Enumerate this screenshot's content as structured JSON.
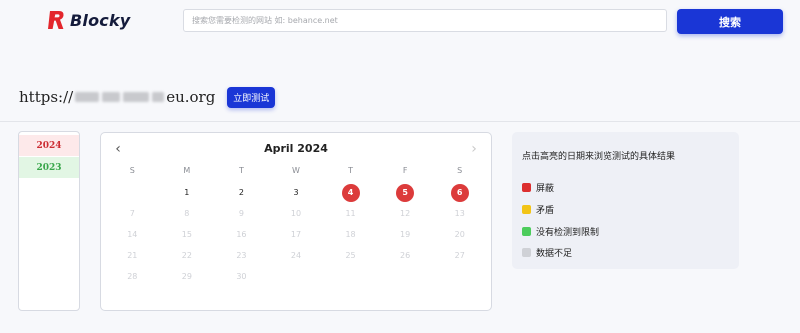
{
  "header": {
    "logo_text": "Blocky",
    "search": {
      "placeholder": "搜索您需要检测的网站 如: behance.net",
      "value": ""
    },
    "search_button": "搜索"
  },
  "target": {
    "url_prefix": "https://",
    "url_suffix": "eu.org",
    "test_button": "立即测试"
  },
  "years": [
    {
      "label": "2024",
      "status": "blocked"
    },
    {
      "label": "2023",
      "status": "ok"
    }
  ],
  "calendar": {
    "title": "April 2024",
    "prev_icon": "chevron-left-icon",
    "next_icon": "chevron-right-icon",
    "weekdays": [
      "S",
      "M",
      "T",
      "W",
      "T",
      "F",
      "S"
    ],
    "leading_blanks": 1,
    "days": [
      {
        "d": "1",
        "state": "active"
      },
      {
        "d": "2",
        "state": "active"
      },
      {
        "d": "3",
        "state": "active"
      },
      {
        "d": "4",
        "state": "blocked"
      },
      {
        "d": "5",
        "state": "blocked"
      },
      {
        "d": "6",
        "state": "blocked"
      },
      {
        "d": "7",
        "state": "disabled"
      },
      {
        "d": "8",
        "state": "disabled"
      },
      {
        "d": "9",
        "state": "disabled"
      },
      {
        "d": "10",
        "state": "disabled"
      },
      {
        "d": "11",
        "state": "disabled"
      },
      {
        "d": "12",
        "state": "disabled"
      },
      {
        "d": "13",
        "state": "disabled"
      },
      {
        "d": "14",
        "state": "disabled"
      },
      {
        "d": "15",
        "state": "disabled"
      },
      {
        "d": "16",
        "state": "disabled"
      },
      {
        "d": "17",
        "state": "disabled"
      },
      {
        "d": "18",
        "state": "disabled"
      },
      {
        "d": "19",
        "state": "disabled"
      },
      {
        "d": "20",
        "state": "disabled"
      },
      {
        "d": "21",
        "state": "disabled"
      },
      {
        "d": "22",
        "state": "disabled"
      },
      {
        "d": "23",
        "state": "disabled"
      },
      {
        "d": "24",
        "state": "disabled"
      },
      {
        "d": "25",
        "state": "disabled"
      },
      {
        "d": "26",
        "state": "disabled"
      },
      {
        "d": "27",
        "state": "disabled"
      },
      {
        "d": "28",
        "state": "disabled"
      },
      {
        "d": "29",
        "state": "disabled"
      },
      {
        "d": "30",
        "state": "disabled"
      }
    ]
  },
  "legend": {
    "title": "点击高亮的日期来浏览测试的具体结果",
    "items": [
      {
        "label": "屏蔽",
        "color": "#dc2f2f"
      },
      {
        "label": "矛盾",
        "color": "#f2c417"
      },
      {
        "label": "没有检测到限制",
        "color": "#4ccc5c"
      },
      {
        "label": "数据不足",
        "color": "#cfd1d6"
      }
    ]
  },
  "colors": {
    "accent": "#1a36d6",
    "blocked": "#dc3b3b",
    "logo_red": "#e3262c"
  }
}
